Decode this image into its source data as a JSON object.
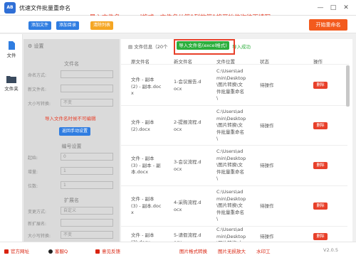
{
  "app": {
    "title": "优速文件批量重命名",
    "icon_text": "AB"
  },
  "window_controls": {
    "minimize": "—",
    "maximize": "□",
    "close": "✕"
  },
  "toolbar": {
    "add_file": "添加文件",
    "add_folder": "添加目录",
    "clear_list": "清除列表",
    "start": "开始重命名"
  },
  "instruction": "导入文件名，excel格式，文件名从第1列的第1格开始依次往下填写",
  "sidebar": [
    {
      "label": "文件",
      "icon": "file-icon"
    },
    {
      "label": "文件夹",
      "icon": "folder-icon"
    }
  ],
  "settings": {
    "title": "设置",
    "section_filename": "文件名",
    "rows": [
      {
        "label": "命名方式:",
        "value": ""
      },
      {
        "label": "新文件名:",
        "value": ""
      },
      {
        "label": "大小写转换:",
        "value": "不变"
      }
    ],
    "note": "导入文件名时候不可编辑",
    "manual_button": "返回手动设置",
    "section_number": "编号设置",
    "number_rows": [
      {
        "label": "起始:",
        "value": "0"
      },
      {
        "label": "增量:",
        "value": "1"
      },
      {
        "label": "位数:",
        "value": "1"
      }
    ],
    "section_ext": "扩展名",
    "ext_rows": [
      {
        "label": "变更方式:",
        "value": "自定义"
      },
      {
        "label": "新扩展名:",
        "value": ""
      },
      {
        "label": "大小写转换:",
        "value": "不变"
      }
    ]
  },
  "file_info": {
    "label": "文件信息（20个",
    "import_button": "导入文件名(excel格式)",
    "status": "导入成功"
  },
  "table": {
    "headers": [
      "原文件名",
      "新文件名",
      "文件位置",
      "状态",
      "操作"
    ],
    "rows": [
      {
        "orig": "文件 - 副本\n(2) - 副本.doc\nx",
        "new": "1-会议报告.d\nocx",
        "path": "C:\\Users\\ad\nmin\\Desktop\n\\图片转换\\文\n件批量重命名\n\\",
        "status": "待操作",
        "action": "删除"
      },
      {
        "orig": "文件 - 副本\n(2).docx",
        "new": "2-提报流程.d\nocx",
        "path": "C:\\Users\\ad\nmin\\Desktop\n\\图片转换\\文\n件批量重命名\n\\",
        "status": "待操作",
        "action": "删除"
      },
      {
        "orig": "文件 - 副本\n(3) - 副本 - 副\n本.docx",
        "new": "3-会议流程.d\nocx",
        "path": "C:\\Users\\ad\nmin\\Desktop\n\\图片转换\\文\n件批量重命名\n\\",
        "status": "待操作",
        "action": "删除"
      },
      {
        "orig": "文件 - 副本\n(3) - 副本.doc\nx",
        "new": "4-采购流程.d\nocx",
        "path": "C:\\Users\\ad\nmin\\Desktop\n\\图片转换\\文\n件批量重命名\n\\",
        "status": "待操作",
        "action": "删除"
      },
      {
        "orig": "文件 - 副本\n(3).docx",
        "new": "5-请假流程.d\nocx",
        "path": "C:\\Users\\ad\nmin\\Desktop\n\\图片转换\\文\n件批量重命名\n\\",
        "status": "待操作",
        "action": "删除"
      }
    ]
  },
  "footer": {
    "website": "官方网址",
    "service": "客服Q",
    "feedback": "意见反馈",
    "img_convert": "图片格式转换",
    "img_enlarge": "图片无损放大",
    "watermark": "水印工",
    "version": "V2.0.5"
  },
  "colors": {
    "accent_red": "#e8402a",
    "brand_blue": "#2f7de1",
    "success_green": "#2cae3c",
    "clear_orange": "#f5a623",
    "start_orange": "#f35a1d"
  }
}
